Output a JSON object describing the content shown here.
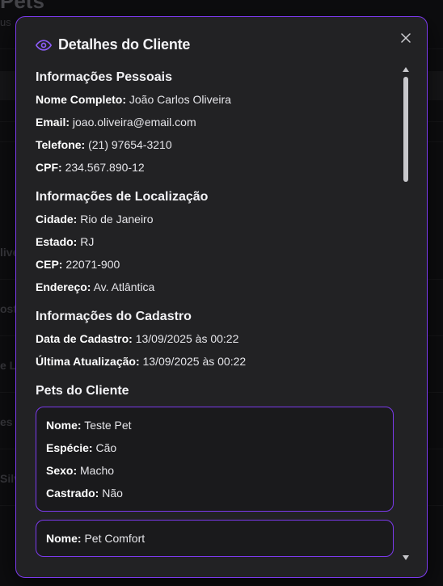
{
  "background": {
    "title": "Pets",
    "subtitle": "us",
    "rows": [
      "live",
      "ost",
      "e L",
      "es (",
      "Silv"
    ]
  },
  "modal": {
    "title": "Detalhes do Cliente",
    "icon": "eye-icon",
    "close_icon": "close-icon",
    "accent": "#7c3aed"
  },
  "personal": {
    "title": "Informações Pessoais",
    "name_label": "Nome Completo:",
    "name_value": "João Carlos Oliveira",
    "email_label": "Email:",
    "email_value": "joao.oliveira@email.com",
    "phone_label": "Telefone:",
    "phone_value": "(21) 97654-3210",
    "cpf_label": "CPF:",
    "cpf_value": "234.567.890-12"
  },
  "location": {
    "title": "Informações de Localização",
    "city_label": "Cidade:",
    "city_value": "Rio de Janeiro",
    "state_label": "Estado:",
    "state_value": "RJ",
    "cep_label": "CEP:",
    "cep_value": "22071-900",
    "address_label": "Endereço:",
    "address_value": "Av. Atlântica"
  },
  "registration": {
    "title": "Informações do Cadastro",
    "created_label": "Data de Cadastro:",
    "created_value": "13/09/2025 às 00:22",
    "updated_label": "Última Atualização:",
    "updated_value": "13/09/2025 às 00:22"
  },
  "pets": {
    "title": "Pets do Cliente",
    "items": [
      {
        "name_label": "Nome:",
        "name_value": "Teste Pet",
        "species_label": "Espécie:",
        "species_value": "Cão",
        "sex_label": "Sexo:",
        "sex_value": "Macho",
        "neutered_label": "Castrado:",
        "neutered_value": "Não"
      },
      {
        "name_label": "Nome:",
        "name_value": "Pet Comfort"
      }
    ]
  }
}
